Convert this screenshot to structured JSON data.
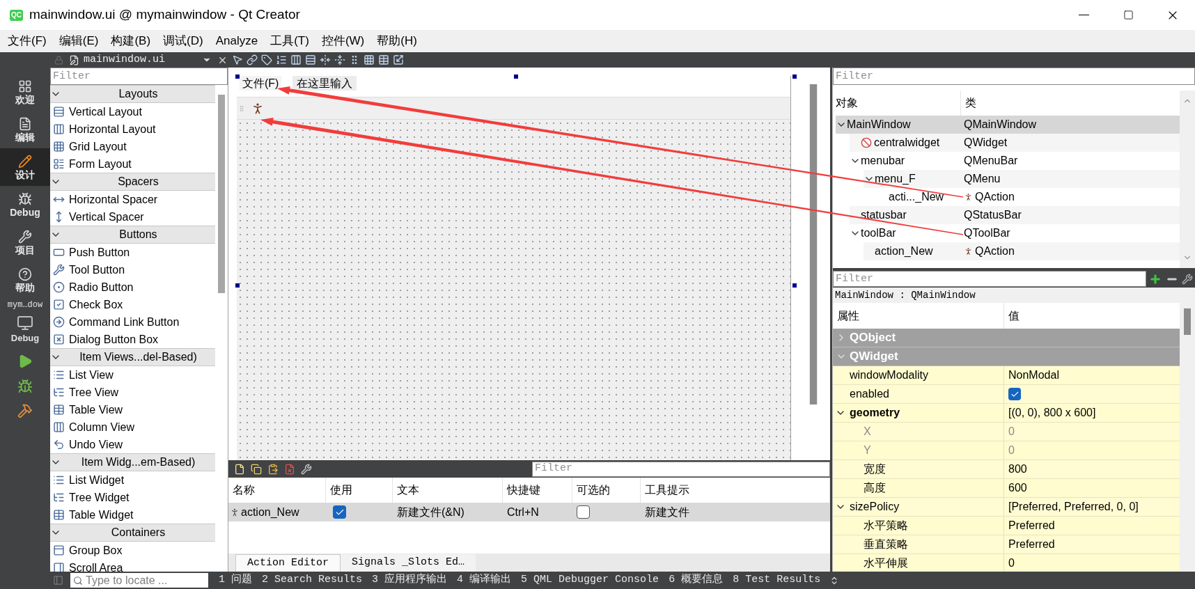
{
  "window": {
    "logo_text": "QC",
    "title": "mainwindow.ui @ mymainwindow - Qt Creator"
  },
  "menu": [
    "文件(F)",
    "编辑(E)",
    "构建(B)",
    "调试(D)",
    "Analyze",
    "工具(T)",
    "控件(W)",
    "帮助(H)"
  ],
  "editor_tab": {
    "file": "mainwindow.ui"
  },
  "modes": [
    {
      "label": "欢迎",
      "selected": false
    },
    {
      "label": "编辑",
      "selected": false
    },
    {
      "label": "设计",
      "selected": true
    },
    {
      "label": "Debug",
      "selected": false
    },
    {
      "label": "项目",
      "selected": false
    },
    {
      "label": "帮助",
      "selected": false
    }
  ],
  "build": {
    "project": "mym…dow",
    "config": "Debug"
  },
  "widget_box": {
    "filter_placeholder": "Filter",
    "groups": [
      {
        "title": "Layouts",
        "expanded": true,
        "items": [
          "Vertical Layout",
          "Horizontal Layout",
          "Grid Layout",
          "Form Layout"
        ]
      },
      {
        "title": "Spacers",
        "expanded": true,
        "items": [
          "Horizontal Spacer",
          "Vertical Spacer"
        ]
      },
      {
        "title": "Buttons",
        "expanded": true,
        "items": [
          "Push Button",
          "Tool Button",
          "Radio Button",
          "Check Box",
          "Command Link Button",
          "Dialog Button Box"
        ]
      },
      {
        "title": "Item Views...del-Based)",
        "expanded": true,
        "items": [
          "List View",
          "Tree View",
          "Table View",
          "Column View",
          "Undo View"
        ]
      },
      {
        "title": "Item Widg...em-Based)",
        "expanded": true,
        "items": [
          "List Widget",
          "Tree Widget",
          "Table Widget"
        ]
      },
      {
        "title": "Containers",
        "expanded": true,
        "items": [
          "Group Box",
          "Scroll Area"
        ]
      }
    ]
  },
  "form": {
    "menubar": [
      {
        "label": "文件(F)",
        "kind": "menu"
      },
      {
        "label": "在这里输入",
        "kind": "placeholder"
      }
    ]
  },
  "action_editor": {
    "filter_placeholder": "Filter",
    "columns": [
      "名称",
      "使用",
      "文本",
      "快捷键",
      "可选的",
      "工具提示"
    ],
    "rows": [
      {
        "name": "action_New",
        "used": true,
        "text": "新建文件(&N)",
        "shortcut": "Ctrl+N",
        "checkable": false,
        "tooltip": "新建文件",
        "selected": true
      }
    ],
    "tabs": [
      {
        "label": "Action Editor",
        "selected": true
      },
      {
        "label": "Signals _Slots Ed…",
        "selected": false
      }
    ]
  },
  "object_inspector": {
    "filter_placeholder": "Filter",
    "columns": [
      "对象",
      "类"
    ],
    "tree": [
      {
        "name": "MainWindow",
        "class": "QMainWindow",
        "selected": true,
        "children": [
          {
            "name": "centralwidget",
            "class": "QWidget",
            "kind": "central",
            "selected": false
          },
          {
            "name": "menubar",
            "class": "QMenuBar",
            "selected": false,
            "children": [
              {
                "name": "menu_F",
                "class": "QMenu",
                "selected": false,
                "children": [
                  {
                    "name": "acti..._New",
                    "class": "QAction",
                    "kind": "action",
                    "selected": false
                  }
                ]
              }
            ]
          },
          {
            "name": "statusbar",
            "class": "QStatusBar",
            "selected": false
          },
          {
            "name": "toolBar",
            "class": "QToolBar",
            "selected": false,
            "children": [
              {
                "name": "action_New",
                "class": "QAction",
                "kind": "action",
                "selected": false
              }
            ]
          }
        ]
      }
    ]
  },
  "property_editor": {
    "filter_placeholder": "Filter",
    "object_label": "MainWindow : QMainWindow",
    "columns": [
      "属性",
      "值"
    ],
    "rows": [
      {
        "name": "QObject",
        "kind": "group",
        "expanded": false
      },
      {
        "name": "QWidget",
        "kind": "group",
        "expanded": true
      },
      {
        "name": "windowModality",
        "kind": "text",
        "value": "NonModal",
        "changed": false,
        "disabled": false
      },
      {
        "name": "enabled",
        "kind": "check",
        "checked": true,
        "changed": false,
        "disabled": false
      },
      {
        "name": "geometry",
        "kind": "text",
        "value": "[(0, 0), 800 x 600]",
        "changed": true,
        "disabled": false,
        "expanded": true,
        "children": [
          {
            "name": "X",
            "kind": "text",
            "value": "0",
            "changed": false,
            "disabled": true
          },
          {
            "name": "Y",
            "kind": "text",
            "value": "0",
            "changed": false,
            "disabled": true
          },
          {
            "name": "宽度",
            "kind": "text",
            "value": "800",
            "changed": false,
            "disabled": false
          },
          {
            "name": "高度",
            "kind": "text",
            "value": "600",
            "changed": false,
            "disabled": false
          }
        ]
      },
      {
        "name": "sizePolicy",
        "kind": "text",
        "value": "[Preferred, Preferred, 0, 0]",
        "changed": false,
        "disabled": false,
        "expanded": true,
        "children": [
          {
            "name": "水平策略",
            "kind": "text",
            "value": "Preferred",
            "changed": false,
            "disabled": false
          },
          {
            "name": "垂直策略",
            "kind": "text",
            "value": "Preferred",
            "changed": false,
            "disabled": false
          },
          {
            "name": "水平伸展",
            "kind": "text",
            "value": "0",
            "changed": false,
            "disabled": false
          }
        ]
      }
    ]
  },
  "status_bar": {
    "locate_placeholder": "Type to locate ...",
    "panes": [
      "1 问题",
      "2 Search Results",
      "3 应用程序输出",
      "4 编译输出",
      "5 QML Debugger Console",
      "6 概要信息",
      "8 Test Results"
    ]
  }
}
